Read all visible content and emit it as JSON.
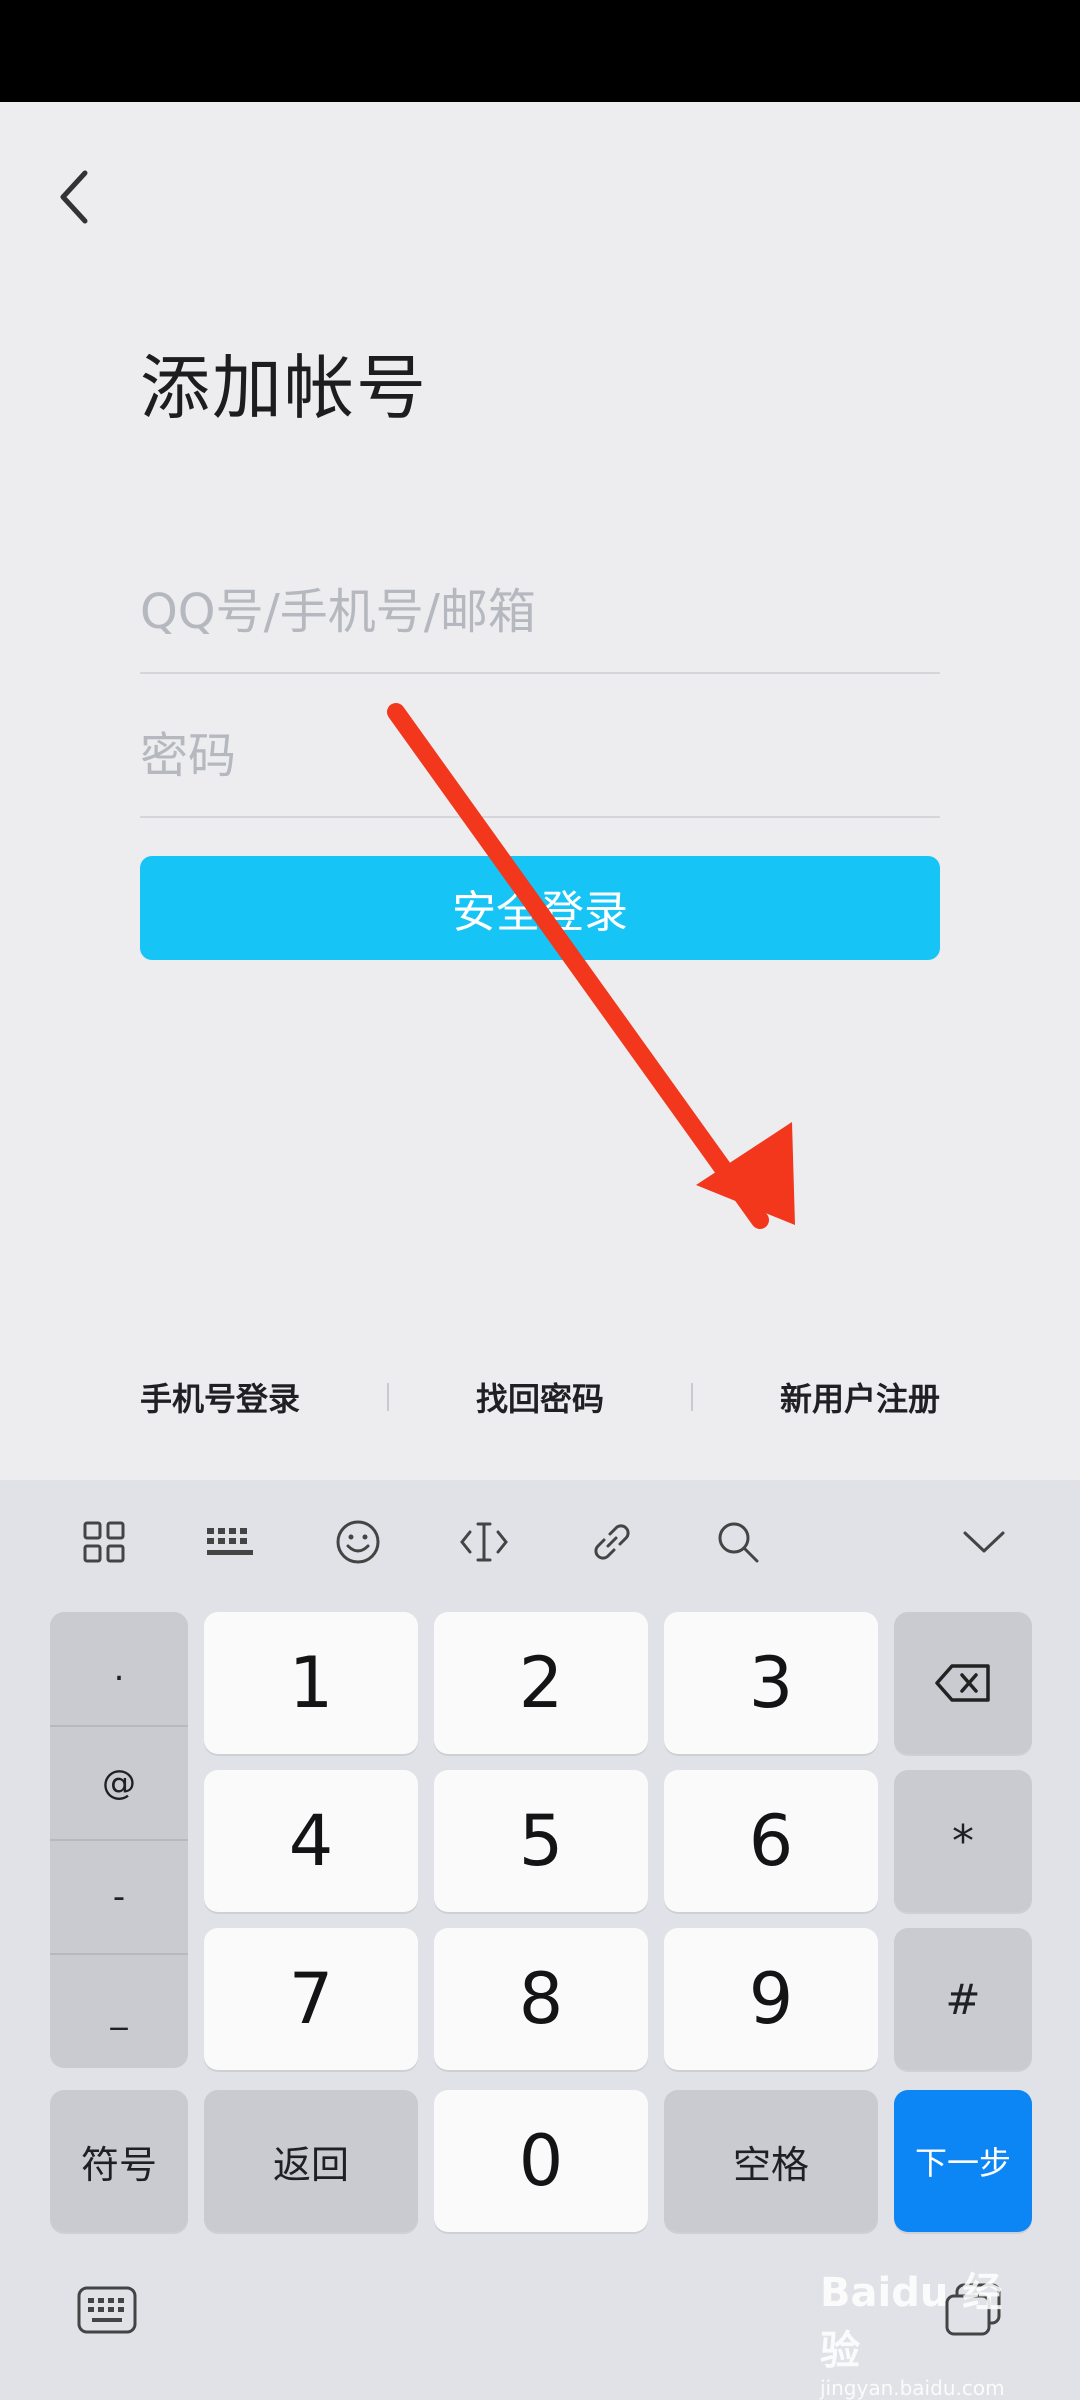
{
  "title": "添加帐号",
  "account_field": {
    "placeholder": "QQ号/手机号/邮箱",
    "value": ""
  },
  "password_field": {
    "placeholder": "密码",
    "value": ""
  },
  "login_button": "安全登录",
  "links": {
    "phone_login": "手机号登录",
    "recover_password": "找回密码",
    "register": "新用户注册"
  },
  "keyboard": {
    "symbols": [
      ".",
      "@",
      "-",
      "_"
    ],
    "digits": [
      "1",
      "2",
      "3",
      "4",
      "5",
      "6",
      "7",
      "8",
      "9",
      "0"
    ],
    "star": "*",
    "hash": "#",
    "symbol_key": "符号",
    "back_key": "返回",
    "space_key": "空格",
    "next_key": "下一步"
  },
  "watermark": {
    "line1": "Baidu 经验",
    "line2": "jingyan.baidu.com"
  },
  "colors": {
    "accent": "#16c5f5",
    "next_key": "#0d86f5",
    "arrow": "#f2371c"
  }
}
